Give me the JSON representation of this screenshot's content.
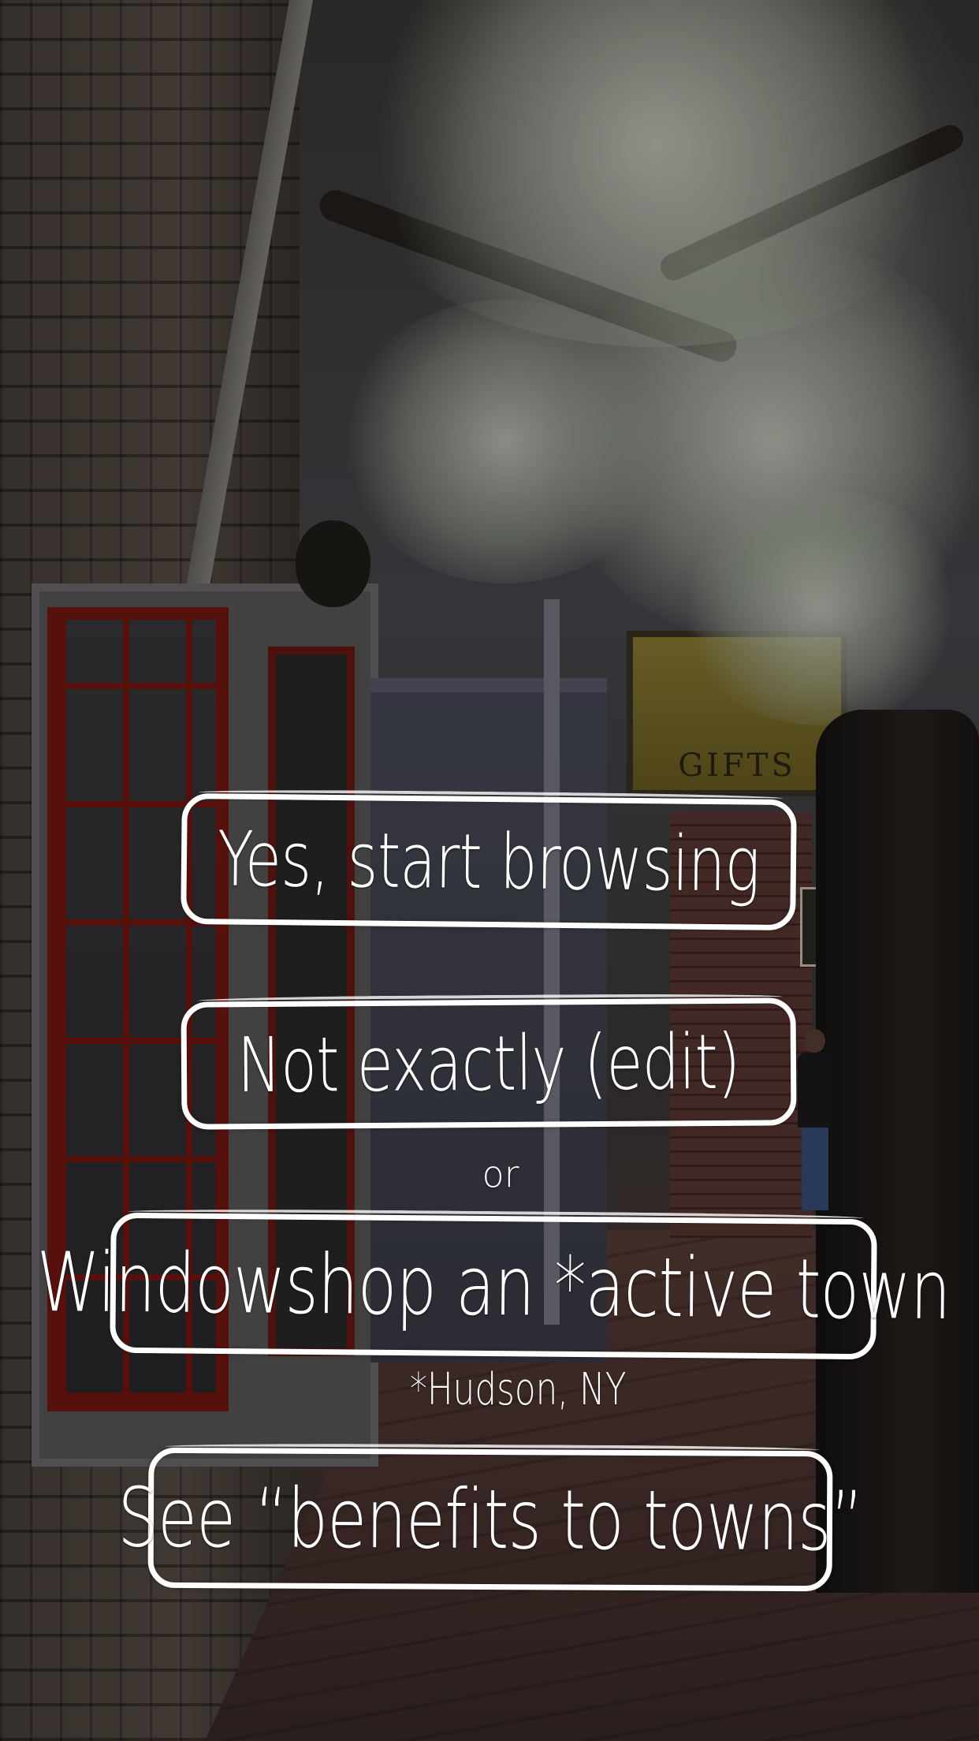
{
  "screen": {
    "background": "street-scene-photo"
  },
  "options": {
    "yes_label": "Yes, start browsing",
    "edit_label": "Not exactly (edit)",
    "separator": "or",
    "windowshop_label": "Windowshop an *active town",
    "footnote": "*Hudson, NY",
    "benefits_label": "See “benefits to towns”"
  },
  "background_signs": {
    "gifts_sign": "GIFTS"
  },
  "colors": {
    "outline": "#ffffff",
    "text": "#ffffff"
  }
}
